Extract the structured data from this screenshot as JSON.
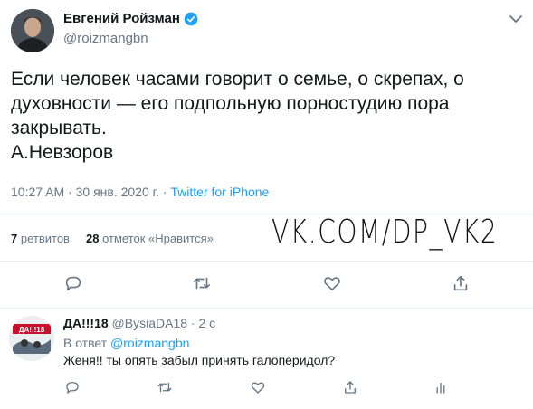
{
  "tweet": {
    "author": {
      "name": "Евгений Ройзман",
      "handle": "@roizmangbn",
      "verified": true
    },
    "text_lines": [
      "Если человек часами говорит о семье, о скрепах, о",
      "духовности — его подпольную порностудию пора",
      "закрывать.",
      "А.Невзоров"
    ],
    "time": "10:27 AM",
    "date": "30 янв. 2020 г.",
    "source": "Twitter for iPhone",
    "retweets_count": "7",
    "retweets_label": "ретвитов",
    "likes_count": "28",
    "likes_label": "отметок «Нравится»"
  },
  "watermark": "VK.COM/DP_VK2",
  "reply": {
    "author_name": "ДА!!!18",
    "author_handle": "@BysiaDA18",
    "time_ago": "2 с",
    "reply_to_label": "В ответ",
    "reply_to_handle": "@roizmangbn",
    "text": "Женя!! ты опять забыл принять галоперидол?",
    "avatar_text": "ДА!!!18"
  },
  "colors": {
    "accent": "#1da1f2",
    "muted": "#657786",
    "text": "#14171a",
    "divider": "#e6ecf0"
  },
  "icons": [
    "chevron-down-icon",
    "verified-badge-icon",
    "reply-icon",
    "retweet-icon",
    "like-icon",
    "share-icon",
    "analytics-icon"
  ]
}
